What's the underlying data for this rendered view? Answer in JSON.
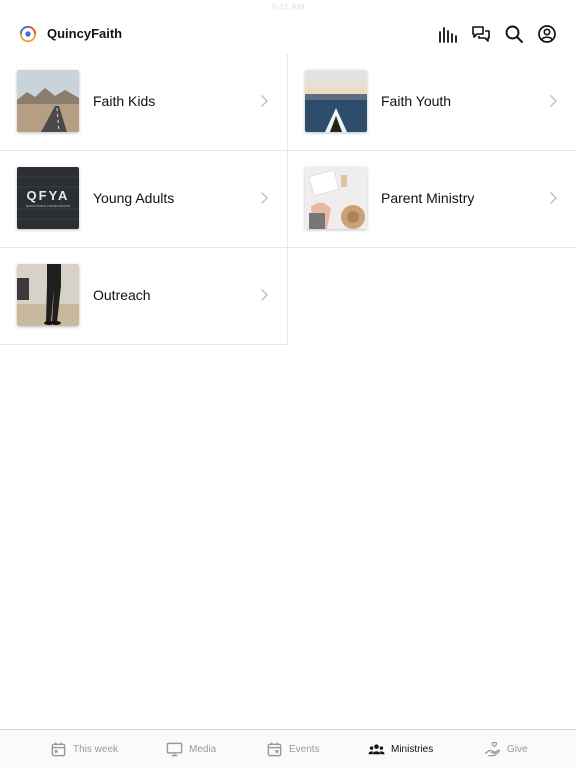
{
  "status": {
    "time": "9:41 AM"
  },
  "header": {
    "title": "QuincyFaith"
  },
  "icons": {
    "logo": "quincyfaith-logo",
    "bars": "audio-bars-icon",
    "chat": "chat-bubbles-icon",
    "search": "search-icon",
    "account": "account-circle-icon"
  },
  "ministries": [
    {
      "label": "Faith Kids",
      "thumb": "desert-road"
    },
    {
      "label": "Faith Youth",
      "thumb": "kayak-lake"
    },
    {
      "label": "Young Adults",
      "thumb": "qfya-brick-wall",
      "thumb_text": "QFYA",
      "thumb_subtext": "QUINCYFAITH YOUNG ADULTS"
    },
    {
      "label": "Parent Ministry",
      "thumb": "hands-hat-table"
    },
    {
      "label": "Outreach",
      "thumb": "person-walking"
    }
  ],
  "tabs": [
    {
      "label": "This week",
      "icon": "calendar-icon"
    },
    {
      "label": "Media",
      "icon": "monitor-icon"
    },
    {
      "label": "Events",
      "icon": "calendar-icon"
    },
    {
      "label": "Ministries",
      "icon": "people-group-icon",
      "active": true
    },
    {
      "label": "Give",
      "icon": "giving-hand-icon"
    }
  ],
  "colors": {
    "active_tab": "#111111",
    "inactive_tab": "#9a9a9a",
    "divider": "#e6e6e6"
  }
}
